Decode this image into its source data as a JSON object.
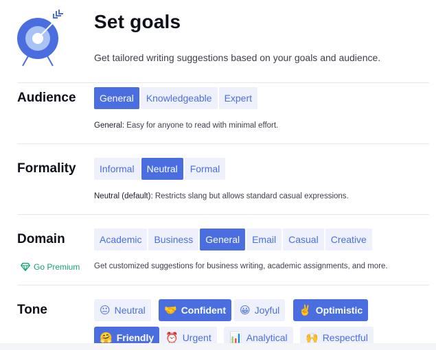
{
  "header": {
    "title": "Set goals",
    "subtitle": "Get tailored writing suggestions based on your goals and audience."
  },
  "audience": {
    "label": "Audience",
    "options": [
      "General",
      "Knowledgeable",
      "Expert"
    ],
    "selected": "General",
    "desc_key": "General:",
    "desc_text": " Easy for anyone to read with minimal effort."
  },
  "formality": {
    "label": "Formality",
    "options": [
      "Informal",
      "Neutral",
      "Formal"
    ],
    "selected": "Neutral",
    "desc_key": "Neutral (default):",
    "desc_text": " Restricts slang but allows standard casual expressions."
  },
  "domain": {
    "label": "Domain",
    "options": [
      "Academic",
      "Business",
      "General",
      "Email",
      "Casual",
      "Creative"
    ],
    "selected": "General",
    "premium_label": "Go Premium",
    "desc_text": "Get customized suggestions for business writing, academic assignments, and more."
  },
  "tone": {
    "label": "Tone",
    "chips": [
      {
        "emoji": "😐",
        "label": "Neutral",
        "active": false
      },
      {
        "emoji": "🤝",
        "label": "Confident",
        "active": true
      },
      {
        "emoji": "😀",
        "label": "Joyful",
        "active": false
      },
      {
        "emoji": "✌️",
        "label": "Optimistic",
        "active": true
      },
      {
        "emoji": "🤗",
        "label": "Friendly",
        "active": true
      },
      {
        "emoji": "⏰",
        "label": "Urgent",
        "active": false
      },
      {
        "emoji": "📊",
        "label": "Analytical",
        "active": false
      },
      {
        "emoji": "🙌",
        "label": "Respectful",
        "active": false
      }
    ]
  },
  "colors": {
    "accent": "#4a6ee0",
    "chip_bg": "#eef0fb",
    "premium": "#15a36e"
  }
}
